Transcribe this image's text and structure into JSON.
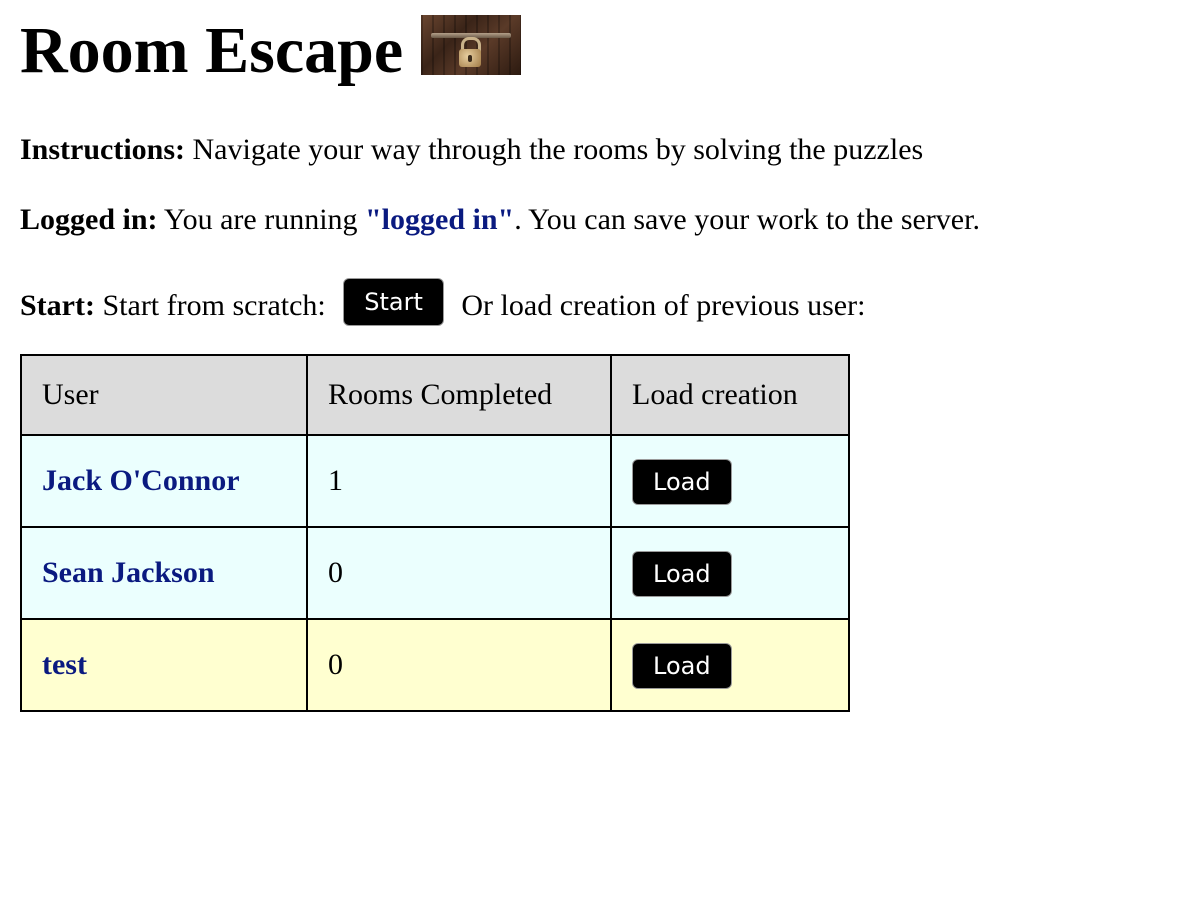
{
  "header": {
    "title": "Room Escape",
    "logo_icon": "padlock-door-image"
  },
  "instructions": {
    "label": "Instructions:",
    "text": " Navigate your way through the rooms by solving the puzzles"
  },
  "login": {
    "label": "Logged in:",
    "text_before": " You are running ",
    "mode": "\"logged in\"",
    "text_after": ". You can save your work to the server."
  },
  "start": {
    "label": "Start:",
    "text_before": " Start from scratch: ",
    "button_label": "Start",
    "text_after": " Or load creation of previous user:"
  },
  "table": {
    "headers": [
      "User",
      "Rooms Completed",
      "Load creation"
    ],
    "rows": [
      {
        "user": "Jack O'Connor",
        "rooms": "1",
        "button": "Load"
      },
      {
        "user": "Sean Jackson",
        "rooms": "0",
        "button": "Load"
      },
      {
        "user": "test",
        "rooms": "0",
        "button": "Load"
      }
    ]
  },
  "colors": {
    "link": "#0a1a80",
    "header_bg": "#dcdcdc",
    "row_cyan": "#ebfffe",
    "row_yellow": "#ffffd0",
    "button_bg": "#000000"
  }
}
